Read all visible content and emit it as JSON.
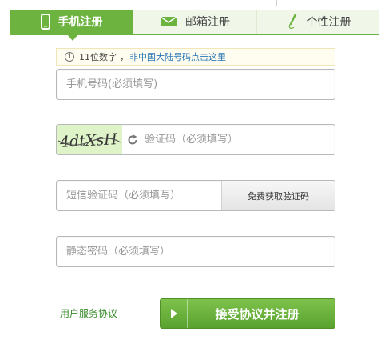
{
  "tabs": [
    {
      "label": "手机注册",
      "icon": "phone-icon",
      "active": true
    },
    {
      "label": "邮箱注册",
      "icon": "envelope-icon",
      "active": false
    },
    {
      "label": "个性注册",
      "icon": "pen-icon",
      "active": false
    }
  ],
  "hint": {
    "text": "11位数字",
    "separator": "，",
    "link": "非中国大陆号码点击这里"
  },
  "form": {
    "phone_placeholder": "手机号码(必须填写)",
    "captcha_placeholder": "验证码（必须填写）",
    "captcha_image_text": "4dtXsH",
    "sms_placeholder": "短信验证码（必须填写）",
    "sms_button": "免费获取验证码",
    "password_placeholder": "静态密码（必须填写）"
  },
  "footer": {
    "agreement_link": "用户服务协议",
    "submit_label": "接受协议并注册"
  },
  "colors": {
    "brand_green": "#6cb33f",
    "link_blue": "#2a76b5",
    "captcha_bg": "#dff3c9"
  }
}
